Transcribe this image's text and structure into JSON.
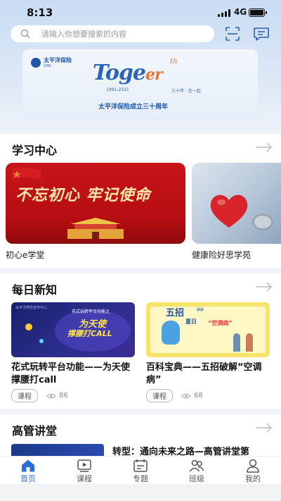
{
  "status": {
    "time": "8:13",
    "network": "4G"
  },
  "search": {
    "placeholder": "请输入你想要搜索的内容"
  },
  "banner": {
    "brand_cn": "太平洋保险",
    "brand_en": "CPIC",
    "word": "Toge",
    "word_g": "th",
    "word_er": "er",
    "years": "1991-2021",
    "motto": "三十年 · 在一起",
    "anniversary": "太平洋保险成立三十周年"
  },
  "study": {
    "title": "学习中心",
    "courses": [
      {
        "label": "初心e学堂",
        "art_text": "不忘初心 牢记使命"
      },
      {
        "label": "健康险好思学苑"
      }
    ]
  },
  "daily": {
    "title": "每日新知",
    "items": [
      {
        "thumb_brand": "太平洋寿险宣传中心",
        "thumb_line1": "花式玩转平台功能之",
        "thumb_line2": "为天使",
        "thumb_line3": "撑腰打CALL",
        "title": "花式玩转平台功能——为天使撑腰打call",
        "tag": "课程",
        "views": "86"
      },
      {
        "thumb_line1": "五招",
        "thumb_line1b": "破解",
        "thumb_line2": "夏日",
        "thumb_line3": "“空调病”",
        "title": "百科宝典——五招破解“空调病”",
        "tag": "课程",
        "views": "68"
      }
    ]
  },
  "exec": {
    "title": "高管讲堂",
    "item_title": "转型：通向未来之路—高管讲堂第"
  },
  "tabs": [
    {
      "label": "首页",
      "icon": "home-icon",
      "active": true
    },
    {
      "label": "课程",
      "icon": "video-icon",
      "active": false
    },
    {
      "label": "专题",
      "icon": "topic-icon",
      "active": false
    },
    {
      "label": "班级",
      "icon": "class-icon",
      "active": false
    },
    {
      "label": "我的",
      "icon": "profile-icon",
      "active": false
    }
  ],
  "colors": {
    "accent": "#2b6fd6",
    "brand_blue": "#1f56a8",
    "red": "#c8151a"
  }
}
